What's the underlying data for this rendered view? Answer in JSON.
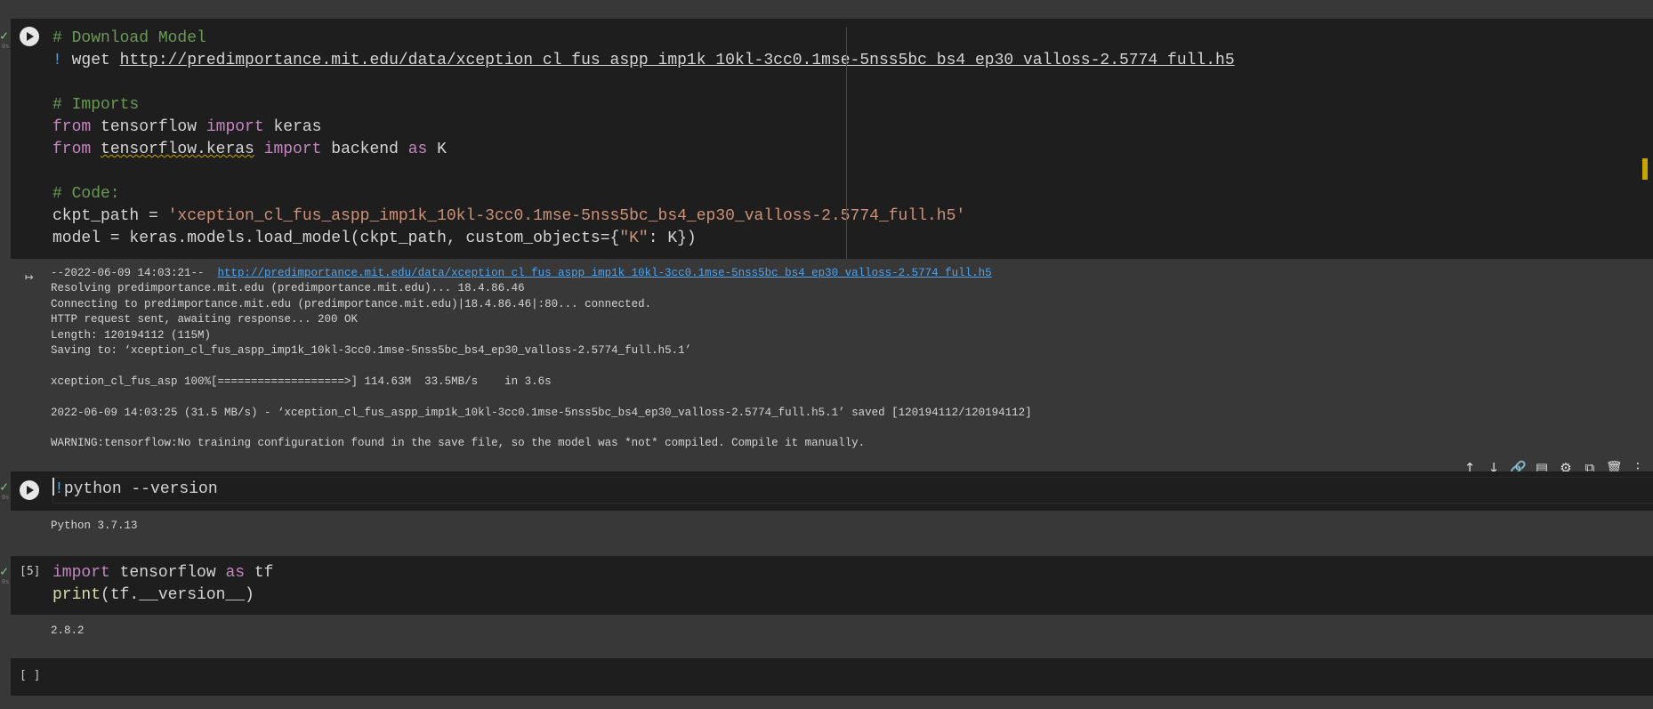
{
  "cell1": {
    "lines": [
      [
        {
          "c": "cm",
          "t": "# Download Model"
        }
      ],
      [
        {
          "c": "bang",
          "t": "! "
        },
        {
          "c": "op",
          "t": "wget "
        },
        {
          "c": "url",
          "t": "http://predimportance.mit.edu/data/xception_cl_fus_aspp_imp1k_10kl-3cc0.1mse-5nss5bc_bs4_ep30_valloss-2.5774_full.h5"
        }
      ],
      [
        {
          "c": "op",
          "t": ""
        }
      ],
      [
        {
          "c": "cm",
          "t": "# Imports"
        }
      ],
      [
        {
          "c": "kw",
          "t": "from "
        },
        {
          "c": "op",
          "t": "tensorflow "
        },
        {
          "c": "kw",
          "t": "import "
        },
        {
          "c": "op",
          "t": "keras"
        }
      ],
      [
        {
          "c": "kw",
          "t": "from "
        },
        {
          "c": "squig",
          "t": "tensorflow.keras"
        },
        {
          "c": "op",
          "t": " "
        },
        {
          "c": "kw",
          "t": "import "
        },
        {
          "c": "op",
          "t": "backend "
        },
        {
          "c": "kw",
          "t": "as "
        },
        {
          "c": "op",
          "t": "K"
        }
      ],
      [
        {
          "c": "op",
          "t": ""
        }
      ],
      [
        {
          "c": "cm",
          "t": "# Code:"
        }
      ],
      [
        {
          "c": "op",
          "t": "ckpt_path = "
        },
        {
          "c": "st",
          "t": "'xception_cl_fus_aspp_imp1k_10kl-3cc0.1mse-5nss5bc_bs4_ep30_valloss-2.5774_full.h5'"
        }
      ],
      [
        {
          "c": "op",
          "t": "model = keras.models.load_model(ckpt_path, custom_objects={"
        },
        {
          "c": "st",
          "t": "\"K\""
        },
        {
          "c": "op",
          "t": ": K})"
        }
      ]
    ],
    "output": {
      "link_prefix": "--2022-06-09 14:03:21--  ",
      "link": "http://predimportance.mit.edu/data/xception_cl_fus_aspp_imp1k_10kl-3cc0.1mse-5nss5bc_bs4_ep30_valloss-2.5774_full.h5",
      "lines": [
        "Resolving predimportance.mit.edu (predimportance.mit.edu)... 18.4.86.46",
        "Connecting to predimportance.mit.edu (predimportance.mit.edu)|18.4.86.46|:80... connected.",
        "HTTP request sent, awaiting response... 200 OK",
        "Length: 120194112 (115M)",
        "Saving to: ‘xception_cl_fus_aspp_imp1k_10kl-3cc0.1mse-5nss5bc_bs4_ep30_valloss-2.5774_full.h5.1’",
        "",
        "xception_cl_fus_asp 100%[===================>] 114.63M  33.5MB/s    in 3.6s",
        "",
        "2022-06-09 14:03:25 (31.5 MB/s) - ‘xception_cl_fus_aspp_imp1k_10kl-3cc0.1mse-5nss5bc_bs4_ep30_valloss-2.5774_full.h5.1’ saved [120194112/120194112]",
        "",
        "WARNING:tensorflow:No training configuration found in the save file, so the model was *not* compiled. Compile it manually."
      ]
    }
  },
  "cell2": {
    "code_bang": "!",
    "code_rest": "python --version",
    "output": "Python 3.7.13"
  },
  "cell3": {
    "exec_count": "[5]",
    "lines": [
      [
        {
          "c": "kw",
          "t": "import "
        },
        {
          "c": "op",
          "t": "tensorflow "
        },
        {
          "c": "kw",
          "t": "as "
        },
        {
          "c": "op",
          "t": "tf"
        }
      ],
      [
        {
          "c": "fn",
          "t": "print"
        },
        {
          "c": "op",
          "t": "(tf.__version__)"
        }
      ]
    ],
    "output": "2.8.2"
  },
  "cell4": {
    "exec_count": "[ ]"
  },
  "gutter": {
    "check": "✓",
    "tiny": "0s"
  },
  "toolbar": {
    "icons": [
      {
        "name": "move-up-icon",
        "glyph": "↑"
      },
      {
        "name": "move-down-icon",
        "glyph": "↓"
      },
      {
        "name": "link-icon",
        "glyph": "🔗"
      },
      {
        "name": "comment-icon",
        "glyph": "▤"
      },
      {
        "name": "settings-icon",
        "glyph": "⚙"
      },
      {
        "name": "mirror-cell-icon",
        "glyph": "⧉"
      },
      {
        "name": "delete-icon",
        "glyph": "🗑"
      },
      {
        "name": "more-icon",
        "glyph": "⋮"
      }
    ]
  },
  "output_icon": "↦"
}
